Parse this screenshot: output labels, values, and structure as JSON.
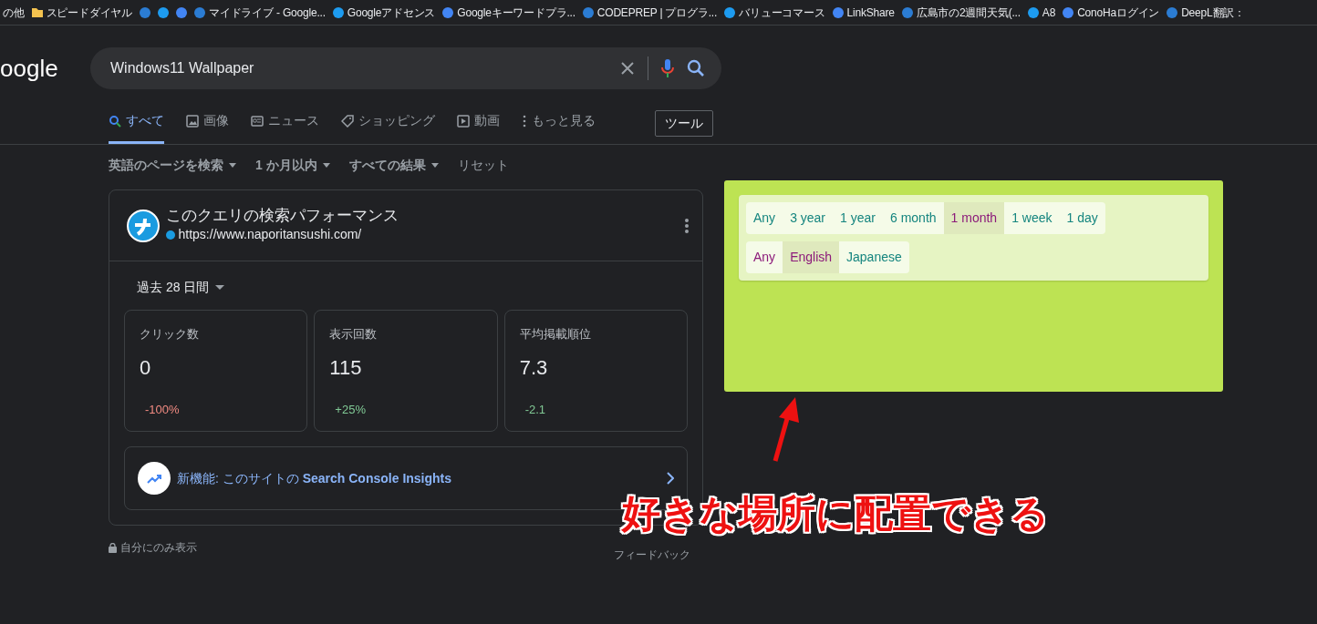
{
  "bookmarks": [
    {
      "label": "の他",
      "kind": "text"
    },
    {
      "label": "スピードダイヤル",
      "kind": "folder"
    },
    {
      "kind": "site"
    },
    {
      "kind": "site"
    },
    {
      "kind": "site"
    },
    {
      "label": "マイドライブ - Google...",
      "kind": "site"
    },
    {
      "label": "Googleアドセンス",
      "kind": "site"
    },
    {
      "label": "Googleキーワードプラ...",
      "kind": "site"
    },
    {
      "label": "CODEPREP | プログラ...",
      "kind": "site"
    },
    {
      "label": "バリューコマース",
      "kind": "site"
    },
    {
      "label": "LinkShare",
      "kind": "site"
    },
    {
      "label": "広島市の2週間天気(...",
      "kind": "site"
    },
    {
      "label": "A8",
      "kind": "site"
    },
    {
      "label": "ConoHaログイン",
      "kind": "site"
    },
    {
      "label": "DeepL翻訳：",
      "kind": "site"
    }
  ],
  "logo": "oogle",
  "search": {
    "value": "Windows11 Wallpaper"
  },
  "tabs": [
    {
      "label": "すべて",
      "selected": true,
      "kind": "search"
    },
    {
      "label": "画像",
      "selected": false,
      "kind": "image"
    },
    {
      "label": "ニュース",
      "selected": false,
      "kind": "news"
    },
    {
      "label": "ショッピング",
      "selected": false,
      "kind": "tag"
    },
    {
      "label": "動画",
      "selected": false,
      "kind": "video"
    },
    {
      "label": "もっと見る",
      "selected": false,
      "kind": "more"
    }
  ],
  "tools_button": "ツール",
  "filters": [
    {
      "label": "英語のページを検索",
      "dropdown": true
    },
    {
      "label": "1 か月以内",
      "dropdown": true
    },
    {
      "label": "すべての結果",
      "dropdown": true
    },
    {
      "label": "リセット",
      "dropdown": false
    }
  ],
  "performance_card": {
    "title": "このクエリの検索パフォーマンス",
    "url": "https://www.naporitansushi.com/",
    "period": "過去 28 日間",
    "metrics": [
      {
        "label": "クリック数",
        "value": "0",
        "change": "-100%",
        "color": "#f28b82"
      },
      {
        "label": "表示回数",
        "value": "115",
        "change": "+25%",
        "color": "#81c995"
      },
      {
        "label": "平均掲載順位",
        "value": "7.3",
        "change": "-2.1",
        "color": "#81c995"
      }
    ],
    "insights_link": "新機能: このサイトの **Search Console Insights**"
  },
  "privacy_note": "自分にのみ表示",
  "feedback": "フィードバック",
  "filter_panel": {
    "rows": [
      [
        {
          "label": "Any",
          "selected": false,
          "visited": false
        },
        {
          "label": "3 year",
          "selected": false,
          "visited": false
        },
        {
          "label": "1 year",
          "selected": false,
          "visited": false
        },
        {
          "label": "6 month",
          "selected": false,
          "visited": false
        },
        {
          "label": "1 month",
          "selected": true,
          "visited": true
        },
        {
          "label": "1 week",
          "selected": false,
          "visited": false
        },
        {
          "label": "1 day",
          "selected": false,
          "visited": false
        }
      ],
      [
        {
          "label": "Any",
          "selected": false,
          "visited": true
        },
        {
          "label": "English",
          "selected": true,
          "visited": true
        },
        {
          "label": "Japanese",
          "selected": false,
          "visited": false
        }
      ]
    ]
  },
  "annotation": "好きな場所に配置できる"
}
